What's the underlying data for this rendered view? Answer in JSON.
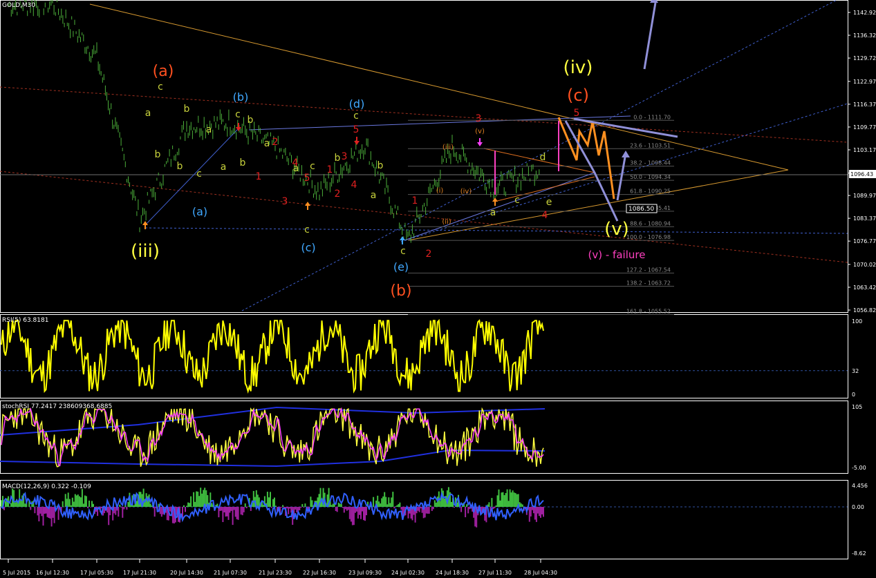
{
  "window": {
    "symbol_title": "GOLD,M30"
  },
  "panels": {
    "price": {
      "title": "GOLD,M30",
      "y_ticks": [
        "1142.92",
        "1136.32",
        "1129.72",
        "1122.97",
        "1116.37",
        "1109.77",
        "1103.17",
        "1096.43",
        "1089.97",
        "1083.37",
        "1076.77",
        "1070.02",
        "1063.42",
        "1056.82"
      ],
      "current_price": "1096.43",
      "projection_label": "1086.50"
    },
    "rsi": {
      "title": "RSI(5) 63.8181",
      "y_ticks": [
        "100",
        "32",
        "0"
      ]
    },
    "stoch": {
      "title": "stochRSI 77.2417 238609368.6885",
      "y_ticks": [
        "105",
        "-5.00"
      ]
    },
    "macd": {
      "title": "MACD(12,26,9) 0.322 -0.109",
      "y_ticks": [
        "4.456",
        "0.00",
        "-8.62"
      ]
    }
  },
  "x_axis": {
    "labels": [
      "5 Jul 2015",
      "16 Jul 12:30",
      "17 Jul 05:30",
      "17 Jul 21:30",
      "20 Jul 14:30",
      "21 Jul 07:30",
      "21 Jul 23:30",
      "22 Jul 16:30",
      "23 Jul 09:30",
      "24 Jul 02:30",
      "24 Jul 18:30",
      "27 Jul 11:30",
      "28 Jul 04:30"
    ]
  },
  "fib_levels": [
    {
      "text": "0.0 - 1111.70"
    },
    {
      "text": "23.6 - 1103.51"
    },
    {
      "text": "38.2 - 1098.44"
    },
    {
      "text": "50.0 - 1094.34"
    },
    {
      "text": "61.8 - 1090.25"
    },
    {
      "text": "76.4 - 1085.41"
    },
    {
      "text": "88.6 - 1080.94"
    },
    {
      "text": "100.0 - 1076.98"
    },
    {
      "text": "127.2 - 1067.54"
    },
    {
      "text": "138.2 - 1063.72"
    },
    {
      "text": "161.8 - 1055.52"
    }
  ],
  "wave_labels": {
    "iii": "(iii)",
    "a_paren": "(a)",
    "a_small_paren": "(a)",
    "b_paren": "(b)",
    "c_paren": "(c)",
    "d_paren": "(d)",
    "e_paren": "(e)",
    "b_big": "(b)",
    "iv": "(iv)",
    "c_orange": "(c)",
    "v": "(v)",
    "failure": "(v) - failure",
    "small": [
      {
        "t": "c",
        "c": "#c8d23c"
      },
      {
        "t": "a",
        "c": "#c8d23c"
      },
      {
        "t": "b",
        "c": "#c8d23c"
      },
      {
        "t": "b",
        "c": "#c8d23c"
      },
      {
        "t": "a",
        "c": "#c8d23c"
      },
      {
        "t": "b",
        "c": "#c8d23c"
      },
      {
        "t": "a",
        "c": "#c8d23c"
      },
      {
        "t": "c",
        "c": "#c8d23c"
      },
      {
        "t": "b",
        "c": "#c8d23c"
      },
      {
        "t": "c",
        "c": "#c8d23c"
      },
      {
        "t": "b",
        "c": "#c8d23c"
      },
      {
        "t": "a",
        "c": "#c8d23c"
      },
      {
        "t": "c",
        "c": "#c8d23c"
      },
      {
        "t": "a",
        "c": "#c8d23c"
      },
      {
        "t": "c",
        "c": "#c8d23c"
      },
      {
        "t": "b",
        "c": "#c8d23c"
      },
      {
        "t": "b",
        "c": "#c8d23c"
      },
      {
        "t": "a",
        "c": "#c8d23c"
      },
      {
        "t": "a",
        "c": "#c8d23c"
      },
      {
        "t": "c",
        "c": "#c8d23c"
      },
      {
        "t": "c",
        "c": "#c8d23c"
      },
      {
        "t": "d",
        "c": "#c8d23c"
      },
      {
        "t": "e",
        "c": "#c8d23c"
      },
      {
        "t": "c",
        "c": "#c8d23c"
      },
      {
        "t": "2",
        "c": "#e02020"
      },
      {
        "t": "1",
        "c": "#e02020"
      },
      {
        "t": "3",
        "c": "#e02020"
      },
      {
        "t": "4",
        "c": "#e02020"
      },
      {
        "t": "5",
        "c": "#e02020"
      },
      {
        "t": "1",
        "c": "#e02020"
      },
      {
        "t": "2",
        "c": "#e02020"
      },
      {
        "t": "3",
        "c": "#e02020"
      },
      {
        "t": "4",
        "c": "#e02020"
      },
      {
        "t": "5",
        "c": "#e02020"
      },
      {
        "t": "1",
        "c": "#e02020"
      },
      {
        "t": "2",
        "c": "#e02020"
      },
      {
        "t": "3",
        "c": "#e02020"
      },
      {
        "t": "4",
        "c": "#e02020"
      },
      {
        "t": "5",
        "c": "#e02020"
      },
      {
        "t": "(i)",
        "c": "#e08020"
      },
      {
        "t": "(ii)",
        "c": "#e08020"
      },
      {
        "t": "(iii)",
        "c": "#e08020"
      },
      {
        "t": "(iv)",
        "c": "#e08020"
      },
      {
        "t": "(v)",
        "c": "#e08020"
      }
    ]
  },
  "colors": {
    "background": "#000000",
    "candles": "#4caf3a",
    "rsi_line": "#ffff00",
    "stoch_k": "#ffff40",
    "stoch_d": "#ff40ff",
    "macd_hist_pos": "#40c040",
    "macd_hist_neg": "#a020a0",
    "macd_line": "#3060ff",
    "orange_wave": "#ff9020",
    "lavender": "#9090d8",
    "magenta": "#ff40c0",
    "yellow_label": "#ffff40",
    "red_label": "#ff5020",
    "blue_label": "#40a8ff"
  },
  "chart_data": {
    "type": "line",
    "title": "GOLD,M30",
    "xlabel": "",
    "ylabel": "",
    "ylim": [
      1053.5,
      1146.2
    ],
    "x": [
      "5 Jul 2015",
      "16 Jul 12:30",
      "17 Jul 05:30",
      "17 Jul 21:30",
      "20 Jul 14:30",
      "21 Jul 07:30",
      "21 Jul 23:30",
      "22 Jul 16:30",
      "23 Jul 09:30",
      "24 Jul 02:30",
      "24 Jul 18:30",
      "27 Jul 11:30",
      "28 Jul 04:30"
    ],
    "series": [
      {
        "name": "",
        "values": [
          1145.0,
          1145.5,
          1130.0,
          1083.0,
          1110.0,
          1111.0,
          1104.0,
          1091.0,
          1105.0,
          1077.0,
          1104.0,
          1092.0,
          1098.0
        ]
      }
    ],
    "grid": false,
    "indicators": [
      "RSI(5) 63.8181",
      "stochRSI 77.2417 238609368.6885",
      "MACD(12,26,9) 0.322 -0.109"
    ]
  }
}
